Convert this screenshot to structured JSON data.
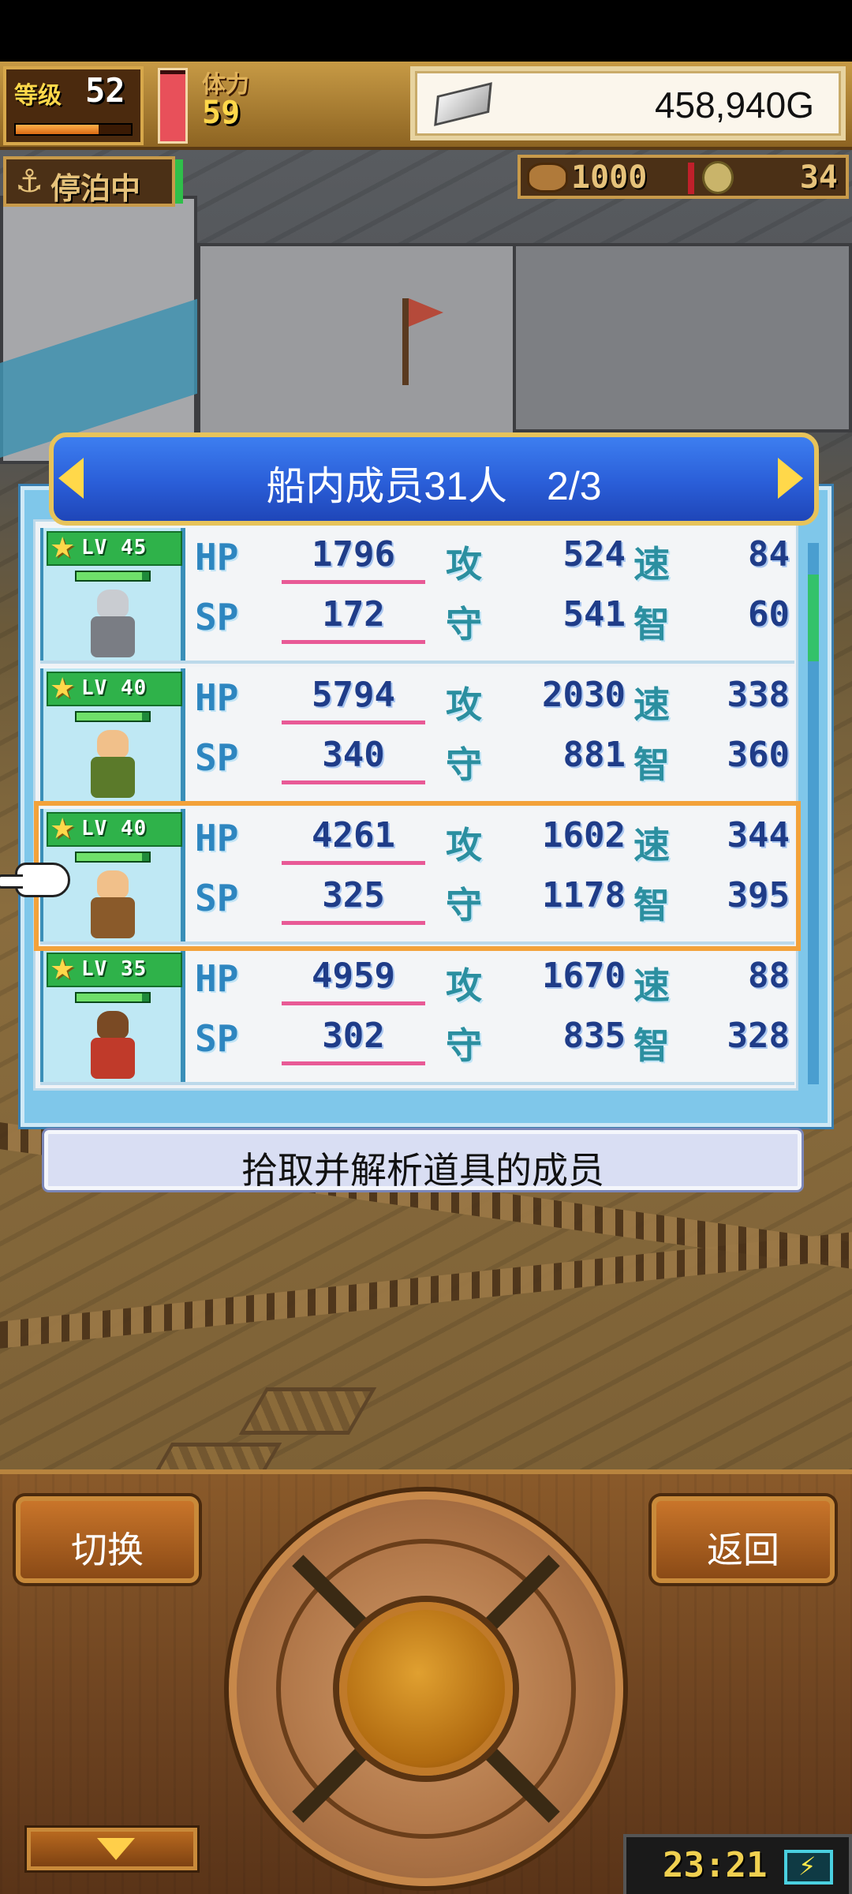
{
  "hud": {
    "level_label": "等级",
    "level": "52",
    "exp_fraction": 0.72,
    "stamina_label": "体力",
    "stamina": "59",
    "stamina_fraction": 0.95,
    "gold": "458,940G",
    "status": "停泊中",
    "supplies": "1000",
    "coins": "34"
  },
  "crew": {
    "title": "船内成员31人　2/3",
    "stat_labels": {
      "hp": "HP",
      "sp": "SP",
      "atk": "攻",
      "def": "守",
      "spd": "速",
      "int": "智"
    },
    "rows": [
      {
        "level": "LV 45",
        "hp": "1796",
        "sp": "172",
        "atk": "524",
        "def": "541",
        "spd": "84",
        "int": "60",
        "hp_fraction": 0.9,
        "selected": false,
        "sprite_colors": [
          "#c9ccd1",
          "#7a7d84"
        ]
      },
      {
        "level": "LV 40",
        "hp": "5794",
        "sp": "340",
        "atk": "2030",
        "def": "881",
        "spd": "338",
        "int": "360",
        "hp_fraction": 0.9,
        "selected": false,
        "sprite_colors": [
          "#f1c08a",
          "#5b7a2a"
        ]
      },
      {
        "level": "LV 40",
        "hp": "4261",
        "sp": "325",
        "atk": "1602",
        "def": "1178",
        "spd": "344",
        "int": "395",
        "hp_fraction": 0.9,
        "selected": true,
        "sprite_colors": [
          "#f1c08a",
          "#8a5a2a"
        ]
      },
      {
        "level": "LV 35",
        "hp": "4959",
        "sp": "302",
        "atk": "1670",
        "def": "835",
        "spd": "88",
        "int": "328",
        "hp_fraction": 0.9,
        "selected": false,
        "sprite_colors": [
          "#7a4a24",
          "#c03a2a"
        ]
      }
    ]
  },
  "description": "拾取并解析道具的成员",
  "controls": {
    "switch_label": "切换",
    "back_label": "返回"
  },
  "clock": "23:21",
  "colors": {
    "title_blue": "#2a5ed8",
    "selection_orange": "#f3a23a",
    "hp_underline": "#e85a96",
    "wood": "#8a5a2a"
  }
}
